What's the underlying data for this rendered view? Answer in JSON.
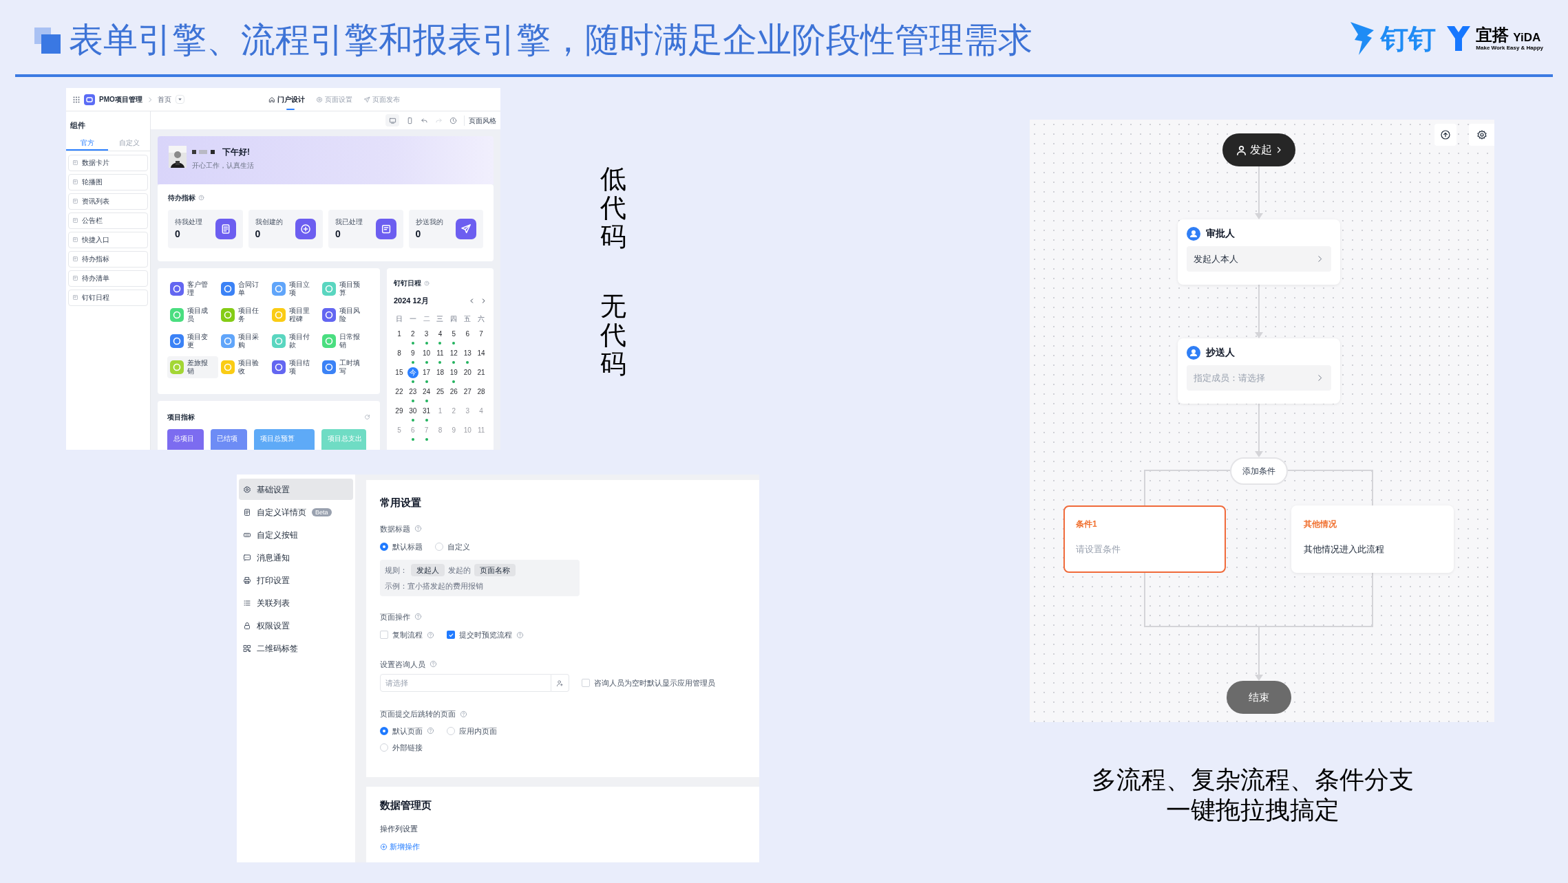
{
  "slide": {
    "title": "表单引擎、流程引擎和报表引擎，随时满足企业阶段性管理需求",
    "logos": [
      {
        "kind": "dingtalk",
        "text": "钉钉"
      },
      {
        "kind": "yida",
        "text": "宜搭",
        "wordmark": "YiDA",
        "tagline": "Make Work Easy & Happy"
      }
    ]
  },
  "portal_designer": {
    "app_name": "PMO项目管理",
    "page": "首页",
    "tabs": [
      {
        "label": "门户设计",
        "selected": true
      },
      {
        "label": "页面设置",
        "selected": false
      },
      {
        "label": "页面发布",
        "selected": false
      }
    ],
    "toolbar_label": "页面风格",
    "components": {
      "title": "组件",
      "tabs": [
        {
          "label": "官方",
          "selected": true
        },
        {
          "label": "自定义",
          "selected": false
        }
      ],
      "items": [
        "数据卡片",
        "轮播图",
        "资讯列表",
        "公告栏",
        "快捷入口",
        "待办指标",
        "待办清单",
        "钉钉日程"
      ]
    },
    "greeting": {
      "text": "下午好!",
      "subtitle": "开心工作，认真生活"
    },
    "todo": {
      "title": "待办指标",
      "tiles": [
        {
          "label": "待我处理",
          "value": "0"
        },
        {
          "label": "我创建的",
          "value": "0"
        },
        {
          "label": "我已处理",
          "value": "0"
        },
        {
          "label": "抄送我的",
          "value": "0"
        }
      ]
    },
    "shortcuts": [
      {
        "label": "客户管理",
        "color": "#6366f1",
        "hovered": false
      },
      {
        "label": "合同订单",
        "color": "#3b82f6",
        "hovered": false
      },
      {
        "label": "项目立项",
        "color": "#60a5fa",
        "hovered": false
      },
      {
        "label": "项目预算",
        "color": "#5ad6c0",
        "hovered": false
      },
      {
        "label": "项目成员",
        "color": "#4ade80",
        "hovered": false
      },
      {
        "label": "项目任务",
        "color": "#84cc16",
        "hovered": false
      },
      {
        "label": "项目里程碑",
        "color": "#facc15",
        "hovered": false
      },
      {
        "label": "项目风险",
        "color": "#6366f1",
        "hovered": false
      },
      {
        "label": "项目变更",
        "color": "#3b82f6",
        "hovered": false
      },
      {
        "label": "项目采购",
        "color": "#60a5fa",
        "hovered": false
      },
      {
        "label": "项目付款",
        "color": "#5ad6c0",
        "hovered": false
      },
      {
        "label": "日常报销",
        "color": "#4ade80",
        "hovered": false
      },
      {
        "label": "差旅报销",
        "color": "#a3d635",
        "hovered": true
      },
      {
        "label": "项目验收",
        "color": "#facc15",
        "hovered": false
      },
      {
        "label": "项目结项",
        "color": "#6366f1",
        "hovered": false
      },
      {
        "label": "工时填写",
        "color": "#3b82f6",
        "hovered": false
      }
    ],
    "calendar": {
      "title": "钉钉日程",
      "month": "2024 12月",
      "weekdays": [
        "日",
        "一",
        "二",
        "三",
        "四",
        "五",
        "六"
      ],
      "days": [
        {
          "label": "1",
          "muted": false,
          "dot": false,
          "today": false
        },
        {
          "label": "2",
          "muted": false,
          "dot": true,
          "today": false
        },
        {
          "label": "3",
          "muted": false,
          "dot": true,
          "today": false
        },
        {
          "label": "4",
          "muted": false,
          "dot": true,
          "today": false
        },
        {
          "label": "5",
          "muted": false,
          "dot": true,
          "today": false
        },
        {
          "label": "6",
          "muted": false,
          "dot": false,
          "today": false
        },
        {
          "label": "7",
          "muted": false,
          "dot": false,
          "today": false
        },
        {
          "label": "8",
          "muted": false,
          "dot": false,
          "today": false
        },
        {
          "label": "9",
          "muted": false,
          "dot": true,
          "today": false
        },
        {
          "label": "10",
          "muted": false,
          "dot": true,
          "today": false
        },
        {
          "label": "11",
          "muted": false,
          "dot": true,
          "today": false
        },
        {
          "label": "12",
          "muted": false,
          "dot": true,
          "today": false
        },
        {
          "label": "13",
          "muted": false,
          "dot": true,
          "today": false
        },
        {
          "label": "14",
          "muted": false,
          "dot": false,
          "today": false
        },
        {
          "label": "15",
          "muted": false,
          "dot": false,
          "today": false
        },
        {
          "label": "今",
          "muted": false,
          "dot": true,
          "today": true
        },
        {
          "label": "17",
          "muted": false,
          "dot": true,
          "today": false
        },
        {
          "label": "18",
          "muted": false,
          "dot": false,
          "today": false
        },
        {
          "label": "19",
          "muted": false,
          "dot": true,
          "today": false
        },
        {
          "label": "20",
          "muted": false,
          "dot": false,
          "today": false
        },
        {
          "label": "21",
          "muted": false,
          "dot": false,
          "today": false
        },
        {
          "label": "22",
          "muted": false,
          "dot": false,
          "today": false
        },
        {
          "label": "23",
          "muted": false,
          "dot": true,
          "today": false
        },
        {
          "label": "24",
          "muted": false,
          "dot": true,
          "today": false
        },
        {
          "label": "25",
          "muted": false,
          "dot": false,
          "today": false
        },
        {
          "label": "26",
          "muted": false,
          "dot": false,
          "today": false
        },
        {
          "label": "27",
          "muted": false,
          "dot": false,
          "today": false
        },
        {
          "label": "28",
          "muted": false,
          "dot": false,
          "today": false
        },
        {
          "label": "29",
          "muted": false,
          "dot": false,
          "today": false
        },
        {
          "label": "30",
          "muted": false,
          "dot": true,
          "today": false
        },
        {
          "label": "31",
          "muted": false,
          "dot": true,
          "today": false
        },
        {
          "label": "1",
          "muted": true,
          "dot": false,
          "today": false
        },
        {
          "label": "2",
          "muted": true,
          "dot": false,
          "today": false
        },
        {
          "label": "3",
          "muted": true,
          "dot": false,
          "today": false
        },
        {
          "label": "4",
          "muted": true,
          "dot": false,
          "today": false
        },
        {
          "label": "5",
          "muted": true,
          "dot": false,
          "today": false
        },
        {
          "label": "6",
          "muted": true,
          "dot": true,
          "today": false
        },
        {
          "label": "7",
          "muted": true,
          "dot": true,
          "today": false
        },
        {
          "label": "8",
          "muted": true,
          "dot": false,
          "today": false
        },
        {
          "label": "9",
          "muted": true,
          "dot": false,
          "today": false
        },
        {
          "label": "10",
          "muted": true,
          "dot": false,
          "today": false
        },
        {
          "label": "11",
          "muted": true,
          "dot": false,
          "today": false
        }
      ]
    },
    "metrics": {
      "title": "项目指标",
      "tiles": [
        {
          "label": "总项目",
          "color": "#7c6cf0"
        },
        {
          "label": "已结项",
          "color": "#6d8cf5"
        },
        {
          "label": "项目总预算",
          "color": "#5eaaf7"
        },
        {
          "label": "项目总支出",
          "color": "#6fdcc4"
        }
      ]
    }
  },
  "side_labels": [
    "低代码",
    "无代码"
  ],
  "form_settings": {
    "nav": [
      {
        "label": "基础设置",
        "selected": true
      },
      {
        "label": "自定义详情页",
        "selected": false,
        "badge": "Beta"
      },
      {
        "label": "自定义按钮",
        "selected": false
      },
      {
        "label": "消息通知",
        "selected": false
      },
      {
        "label": "打印设置",
        "selected": false
      },
      {
        "label": "关联列表",
        "selected": false
      },
      {
        "label": "权限设置",
        "selected": false
      },
      {
        "label": "二维码标签",
        "selected": false
      }
    ],
    "general": {
      "title": "常用设置",
      "data_title": {
        "label": "数据标题",
        "options": [
          {
            "label": "默认标题",
            "selected": true
          },
          {
            "label": "自定义",
            "selected": false
          }
        ],
        "rule_label": "规则：",
        "rule_parts": [
          {
            "kind": "tag",
            "text": "发起人"
          },
          {
            "kind": "text",
            "text": "发起的"
          },
          {
            "kind": "tag",
            "text": "页面名称"
          }
        ],
        "example": "示例：宜小搭发起的费用报销"
      },
      "page_actions": {
        "label": "页面操作",
        "options": [
          {
            "label": "复制流程",
            "checked": false
          },
          {
            "label": "提交时预览流程",
            "checked": true
          }
        ]
      },
      "consultant": {
        "label": "设置咨询人员",
        "placeholder": "请选择",
        "option": {
          "label": "咨询人员为空时默认显示应用管理员",
          "checked": false
        }
      },
      "redirect": {
        "label": "页面提交后跳转的页面",
        "options": [
          {
            "label": "默认页面",
            "selected": true,
            "help": true
          },
          {
            "label": "应用内页面",
            "selected": false,
            "help": false
          },
          {
            "label": "外部链接",
            "selected": false,
            "help": false
          }
        ]
      }
    },
    "data_page": {
      "title": "数据管理页",
      "subtitle": "操作列设置",
      "add_link": "新增操作"
    }
  },
  "flow_designer": {
    "start": "发起",
    "nodes": [
      {
        "title": "审批人",
        "value": "发起人本人",
        "placeholder": false
      },
      {
        "title": "抄送人",
        "value": "指定成员：请选择",
        "placeholder": true
      }
    ],
    "add_condition": "添加条件",
    "branches": [
      {
        "title": "条件1",
        "text": "请设置条件",
        "selected": true,
        "placeholder": true
      },
      {
        "title": "其他情况",
        "text": "其他情况进入此流程",
        "selected": false,
        "placeholder": false
      }
    ],
    "end": "结束"
  },
  "caption": [
    "多流程、复杂流程、条件分支",
    "一键拖拉拽搞定"
  ]
}
